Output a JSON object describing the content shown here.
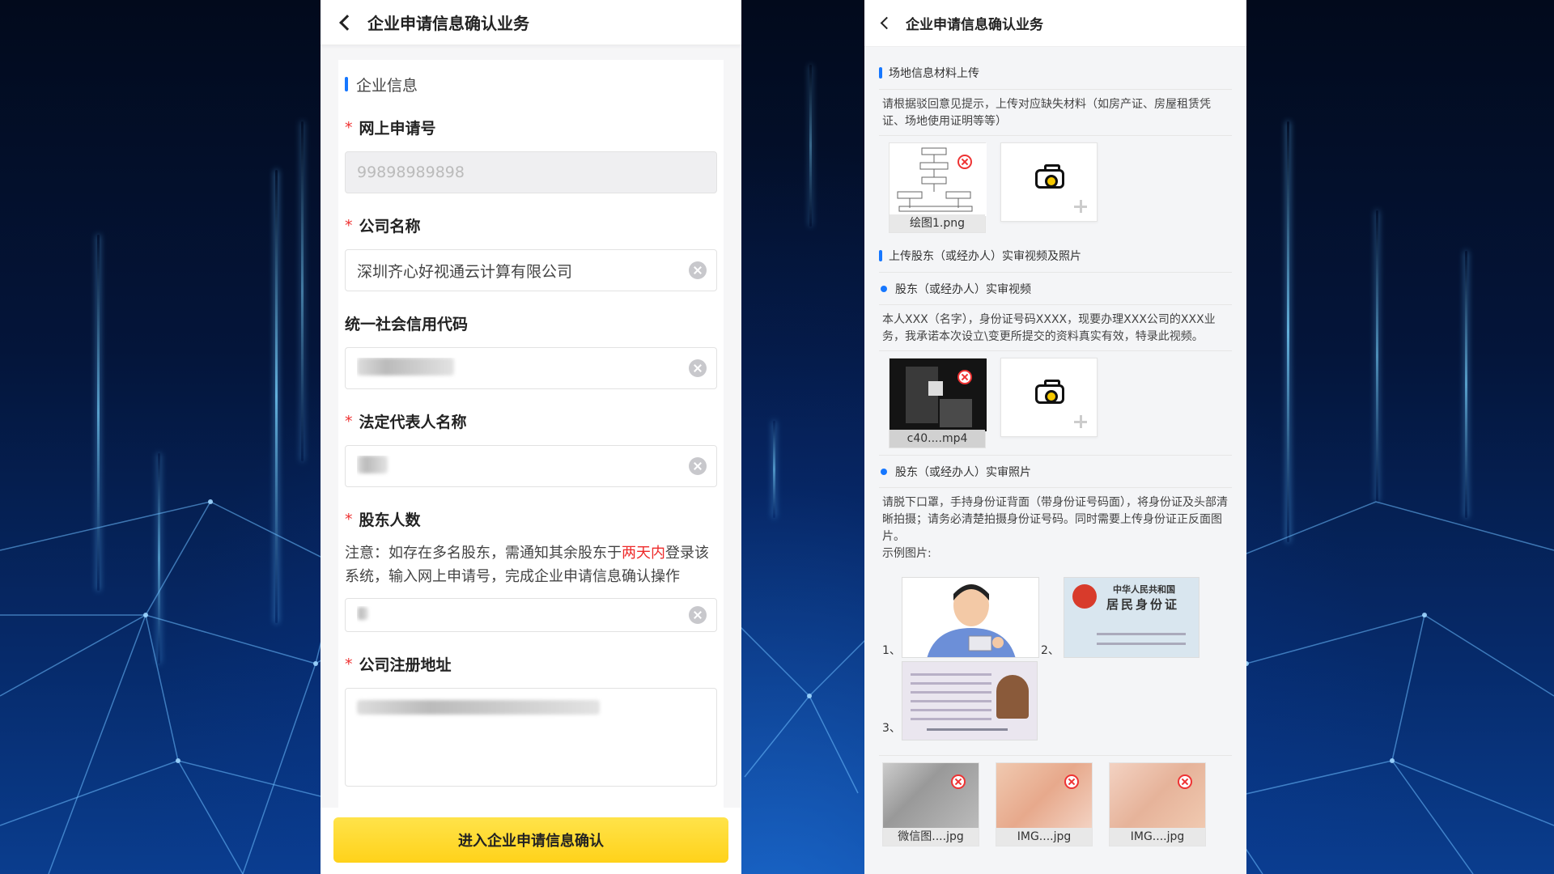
{
  "left": {
    "header": {
      "title": "企业申请信息确认业务"
    },
    "section": "企业信息",
    "fields": {
      "app_no": {
        "label": "网上申请号",
        "placeholder": "99898989898"
      },
      "company": {
        "label": "公司名称",
        "value": "深圳齐心好视通云计算有限公司"
      },
      "credit_code": {
        "label": "统一社会信用代码"
      },
      "legal_rep": {
        "label": "法定代表人名称"
      },
      "shareholders": {
        "label": "股东人数"
      },
      "address": {
        "label": "公司注册地址"
      }
    },
    "notice": {
      "before": "注意：如存在多名股东，需通知其余股东于",
      "highlight": "两天内",
      "after": "登录该系统，输入网上申请号，完成企业申请信息确认操作"
    },
    "submit_label": "进入企业申请信息确认"
  },
  "right": {
    "header": {
      "title": "企业申请信息确认业务"
    },
    "site_section": "场地信息材料上传",
    "site_hint": "请根据驳回意见提示，上传对应缺失材料（如房产证、房屋租赁凭证、场地使用证明等等）",
    "site_file": "绘图1.png",
    "video_section": "上传股东（或经办人）实审视频及照片",
    "video_title": "股东（或经办人）实审视频",
    "video_hint": "本人XXX（名字），身份证号码XXXX，现要办理XXX公司的XXX业务，我承诺本次设立\\变更所提交的资料真实有效，特录此视频。",
    "video_file": "c40....mp4",
    "photo_title": "股东（或经办人）实审照片",
    "photo_hint": "请脱下口罩，手持身份证背面（带身份证号码面），将身份证及头部清晰拍摄；请务必清楚拍摄身份证号码。同时需要上传身份证正反面图片。",
    "example_label": "示例图片:",
    "example_nums": [
      "1、",
      "2、",
      "3、"
    ],
    "id_card_title_1": "中华人民共和国",
    "id_card_title_2": "居民身份证",
    "photo_files": [
      "微信图....jpg",
      "IMG....jpg",
      "IMG....jpg"
    ]
  },
  "colors": {
    "accent": "#1677ff",
    "button": "#ffd21a",
    "required": "#ee2a2a"
  }
}
